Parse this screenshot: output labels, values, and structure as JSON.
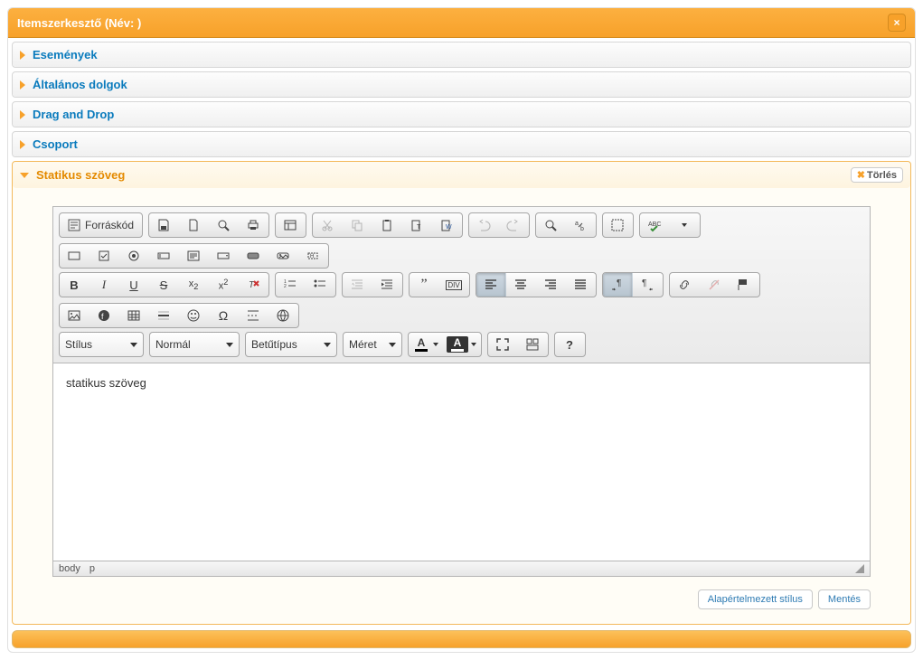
{
  "dialog": {
    "title": "Itemszerkesztő (Név:  )",
    "close_icon": "×"
  },
  "accordion": {
    "events": "Események",
    "general": "Általános dolgok",
    "dragdrop": "Drag and Drop",
    "group": "Csoport",
    "static_text": "Statikus szöveg",
    "delete_btn": "Törlés",
    "delete_x": "✖"
  },
  "toolbar": {
    "source": "Forráskód",
    "style_label": "Stílus",
    "format_label": "Normál",
    "font_label": "Betűtípus",
    "size_label": "Méret",
    "textcolor_letter": "A",
    "bgcolor_letter": "A",
    "help": "?"
  },
  "editor": {
    "content": "statikus szöveg",
    "path_body": "body",
    "path_p": "p"
  },
  "buttons": {
    "default_style": "Alapértelmezett stílus",
    "save": "Mentés"
  }
}
